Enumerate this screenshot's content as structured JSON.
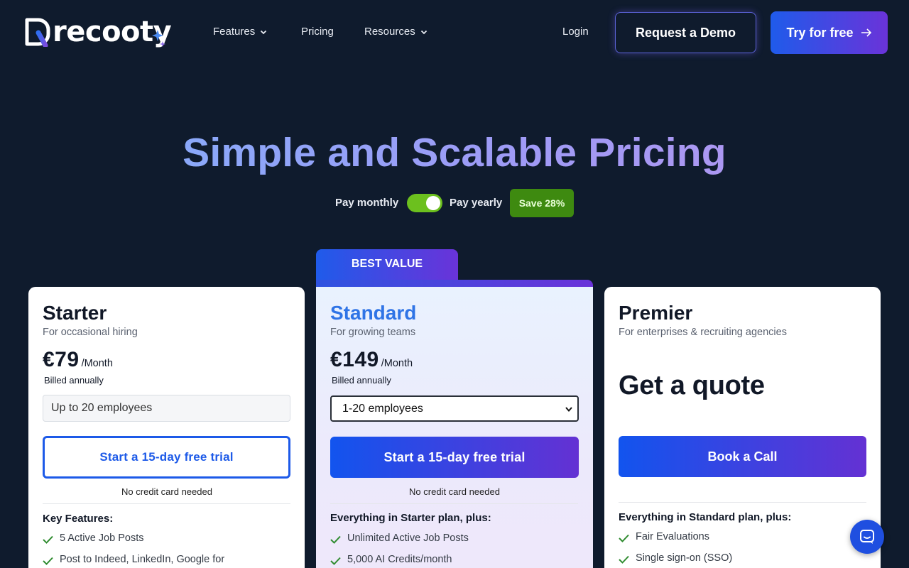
{
  "brand": {
    "name": "recooty"
  },
  "nav": {
    "features": "Features",
    "pricing": "Pricing",
    "resources": "Resources",
    "login": "Login",
    "request_demo": "Request a Demo",
    "try_free": "Try for free"
  },
  "hero": {
    "title": "Simple and Scalable Pricing",
    "pay_monthly": "Pay monthly",
    "pay_yearly": "Pay yearly",
    "save_badge": "Save 28%",
    "yearly_selected": true
  },
  "plans": {
    "starter": {
      "name": "Starter",
      "subtitle": "For occasional hiring",
      "price": "€79",
      "period": "/Month",
      "billed": "Billed annually",
      "employees": "Up to 20 employees",
      "cta": "Start a 15-day free trial",
      "note": "No credit card needed",
      "features_title": "Key Features:",
      "features": [
        "5 Active Job Posts",
        "Post to Indeed, LinkedIn, Google for"
      ]
    },
    "standard": {
      "badge": "BEST VALUE",
      "name": "Standard",
      "subtitle": "For growing teams",
      "price": "€149",
      "period": "/Month",
      "billed": "Billed annually",
      "employees_selected": "1-20 employees",
      "cta": "Start a 15-day free trial",
      "note": "No credit card needed",
      "features_title": "Everything in Starter plan, plus:",
      "features": [
        "Unlimited Active Job Posts",
        "5,000 AI Credits/month"
      ]
    },
    "premier": {
      "name": "Premier",
      "subtitle": "For enterprises & recruiting agencies",
      "quote": "Get a quote",
      "cta": "Book a Call",
      "features_title": "Everything in Standard plan, plus:",
      "features": [
        "Fair Evaluations",
        "Single sign-on (SSO)"
      ]
    }
  },
  "colors": {
    "background": "#0f1b2d",
    "accent_blue": "#1d5ae8",
    "accent_purple": "#6a33d9",
    "toggle_green": "#6cc01e",
    "save_green": "#3e8a10",
    "check_green": "#2e8b2e"
  },
  "icons": {
    "chat": "chat-bubble-icon",
    "arrow": "arrow-right-icon",
    "check": "check-icon",
    "chevron": "chevron-down-icon"
  }
}
